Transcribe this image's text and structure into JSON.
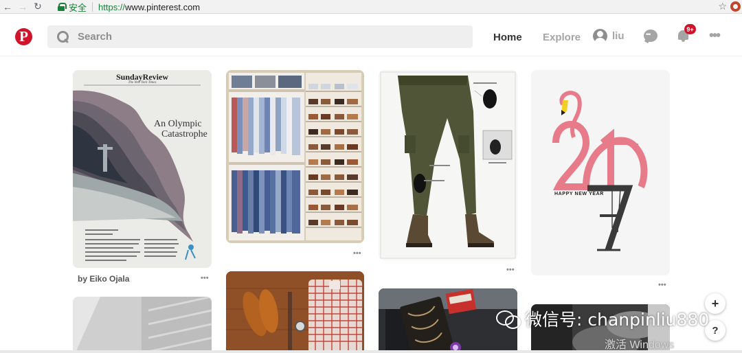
{
  "browser": {
    "back_glyph": "←",
    "forward_glyph": "→",
    "reload_glyph": "↻",
    "secure_label": "安全",
    "url_scheme": "https://",
    "url_rest": "www.pinterest.com",
    "bookmark_glyph": "☆"
  },
  "header": {
    "logo_letter": "P",
    "search_placeholder": "Search",
    "nav_home": "Home",
    "nav_explore": "Explore",
    "user_name": "liu",
    "notification_badge": "9+",
    "more_glyph": "•••"
  },
  "pins": [
    {
      "masthead": "SundayReview",
      "masthead_sub": "The New York Times",
      "headline_line1": "An Olympic",
      "headline_line2": "Catastrophe",
      "caption": "by Eiko Ojala",
      "more": "•••"
    },
    {
      "more": "•••"
    },
    {
      "more": "•••"
    },
    {
      "poster_text": "HAPPY NEW YEAR",
      "more": "•••"
    }
  ],
  "floating": {
    "plus_glyph": "+",
    "help_glyph": "?"
  },
  "overlay": {
    "watermark_text": "微信号: chanpinliu880",
    "activate_text": "激活 Windows"
  },
  "colors": {
    "brand_red": "#d0122a",
    "secure_green": "#188038"
  }
}
